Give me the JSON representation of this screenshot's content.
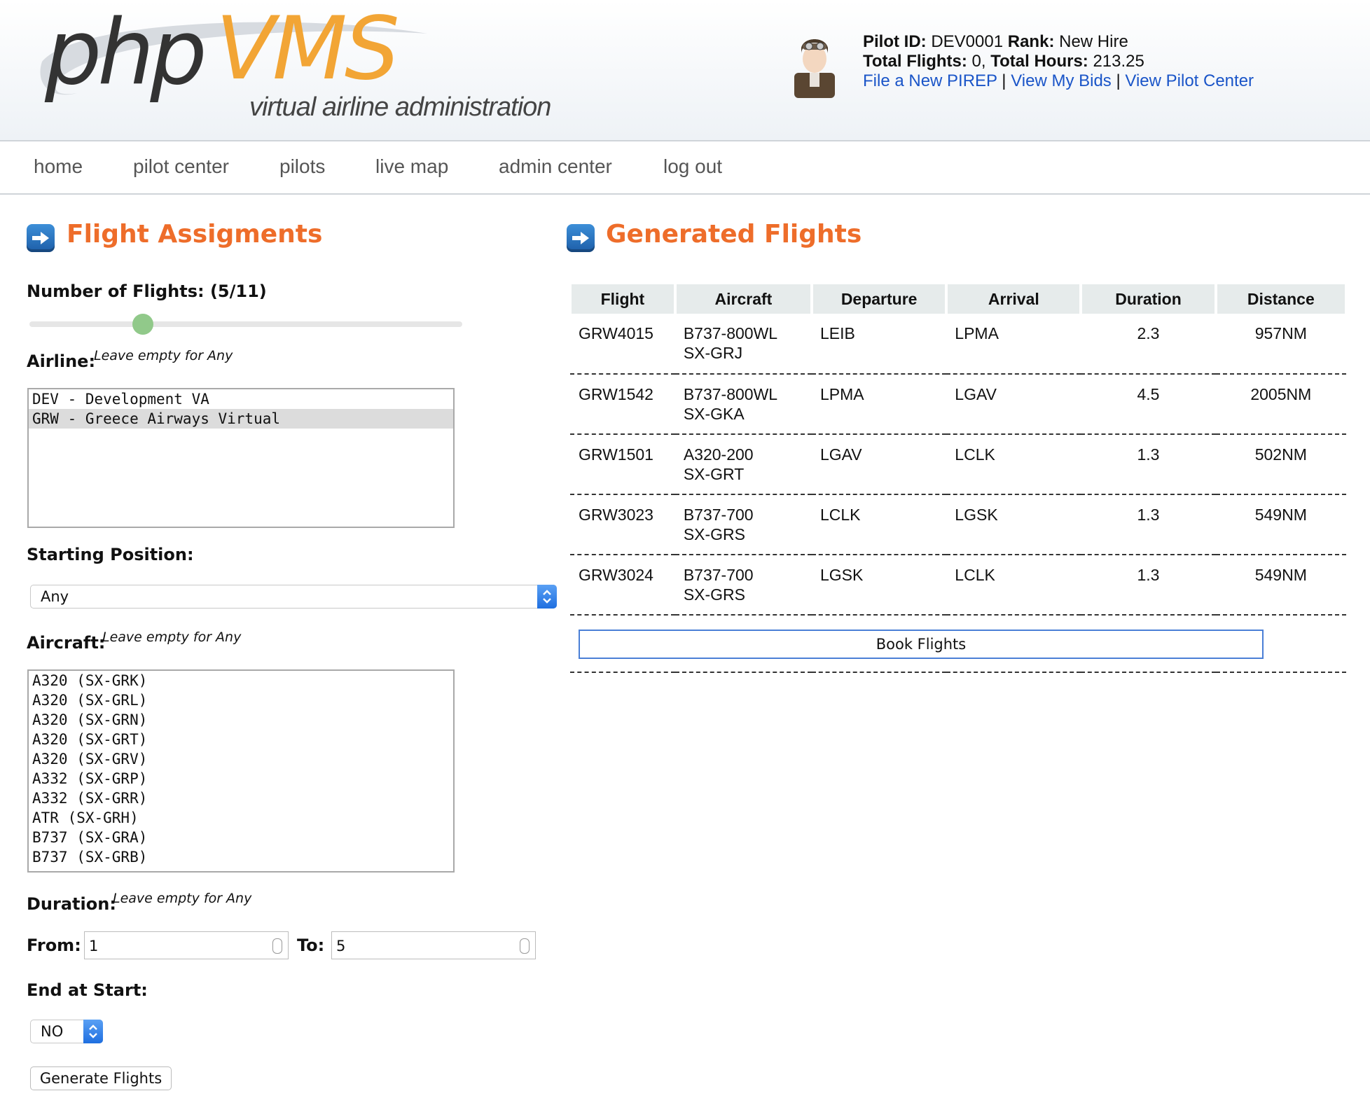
{
  "header": {
    "logo": {
      "php": "php",
      "vms": "VMS",
      "tagline": "virtual airline administration"
    },
    "pilot": {
      "id_label": "Pilot ID:",
      "id_value": "DEV0001",
      "rank_label": "Rank:",
      "rank_value": "New Hire",
      "flights_label": "Total Flights:",
      "flights_value": "0,",
      "hours_label": "Total Hours:",
      "hours_value": "213.25",
      "links": [
        "File a New PIREP",
        "View My Bids",
        "View Pilot Center"
      ],
      "separator": "|"
    }
  },
  "nav": {
    "items": [
      "home",
      "pilot center",
      "pilots",
      "live map",
      "admin center",
      "log out"
    ]
  },
  "assignments": {
    "title": "Flight Assigments",
    "num_flights_label": "Number of Flights: (5/11)",
    "slider": {
      "value": 5,
      "max": 11
    },
    "airline_label": "Airline:",
    "airline_hint": "Leave empty for Any",
    "airlines": [
      "DEV - Development VA",
      "GRW - Greece Airways Virtual"
    ],
    "airline_selected": "GRW - Greece Airways Virtual",
    "start_label": "Starting Position:",
    "start_value": "Any",
    "aircraft_label": "Aircraft:",
    "aircraft_hint": "Leave empty for Any",
    "aircraft": [
      "A320 (SX-GRK)",
      "A320 (SX-GRL)",
      "A320 (SX-GRN)",
      "A320 (SX-GRT)",
      "A320 (SX-GRV)",
      "A332 (SX-GRP)",
      "A332 (SX-GRR)",
      "ATR (SX-GRH)",
      "B737 (SX-GRA)",
      "B737 (SX-GRB)"
    ],
    "duration_label": "Duration:",
    "duration_hint": "Leave empty for Any",
    "from_label": "From:",
    "from_value": "1",
    "to_label": "To:",
    "to_value": "5",
    "end_label": "End at Start:",
    "end_value": "NO",
    "generate_label": "Generate Flights"
  },
  "generated": {
    "title": "Generated Flights",
    "columns": [
      "Flight",
      "Aircraft",
      "Departure",
      "Arrival",
      "Duration",
      "Distance"
    ],
    "rows": [
      {
        "flight": "GRW4015",
        "aircraft": "B737-800WL",
        "reg": "SX-GRJ",
        "dep": "LEIB",
        "arr": "LPMA",
        "duration": "2.3",
        "distance": "957NM"
      },
      {
        "flight": "GRW1542",
        "aircraft": "B737-800WL",
        "reg": "SX-GKA",
        "dep": "LPMA",
        "arr": "LGAV",
        "duration": "4.5",
        "distance": "2005NM"
      },
      {
        "flight": "GRW1501",
        "aircraft": "A320-200",
        "reg": "SX-GRT",
        "dep": "LGAV",
        "arr": "LCLK",
        "duration": "1.3",
        "distance": "502NM"
      },
      {
        "flight": "GRW3023",
        "aircraft": "B737-700",
        "reg": "SX-GRS",
        "dep": "LCLK",
        "arr": "LGSK",
        "duration": "1.3",
        "distance": "549NM"
      },
      {
        "flight": "GRW3024",
        "aircraft": "B737-700",
        "reg": "SX-GRS",
        "dep": "LGSK",
        "arr": "LCLK",
        "duration": "1.3",
        "distance": "549NM"
      }
    ],
    "book_label": "Book Flights"
  },
  "colors": {
    "accent": "#ee6d2a",
    "logo_orange": "#f2a535",
    "link": "#1a55c8",
    "slider_handle": "#91c98a"
  }
}
